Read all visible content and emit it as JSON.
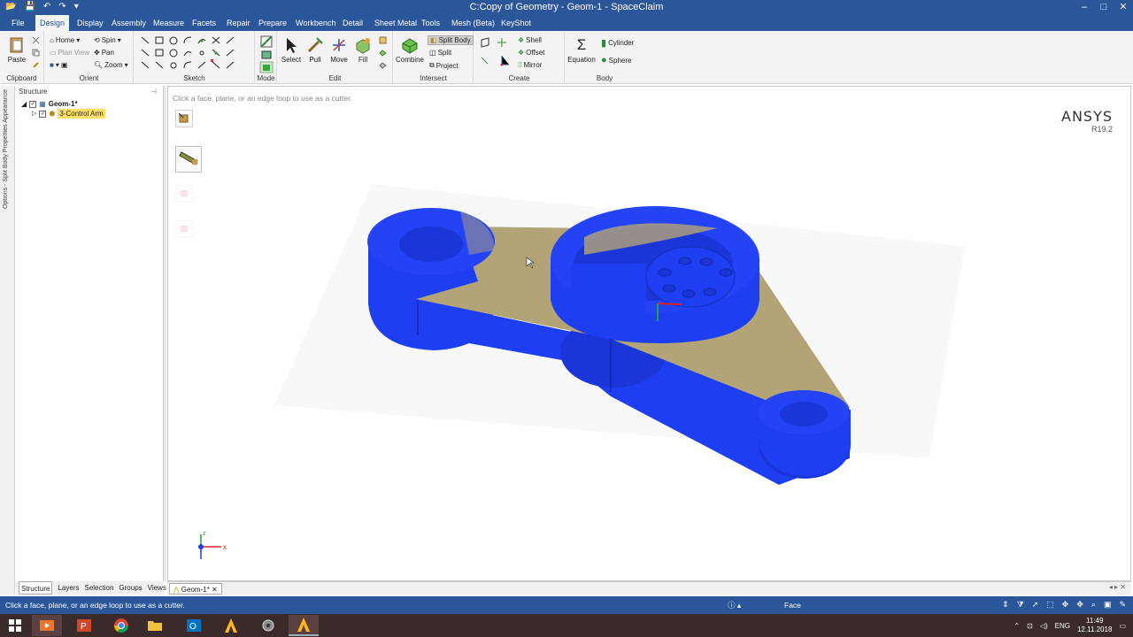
{
  "window": {
    "title": "C:Copy of Geometry - Geom-1 - SpaceClaim",
    "controls": [
      "–",
      "□",
      "✕"
    ]
  },
  "menu": {
    "tabs": [
      "File",
      "Design",
      "Display",
      "Assembly",
      "Measure",
      "Facets",
      "Repair",
      "Prepare",
      "Workbench",
      "Detail",
      "Sheet Metal",
      "Tools",
      "Mesh (Beta)",
      "KeyShot"
    ],
    "active": "Design"
  },
  "ribbon": {
    "clipboard": {
      "label": "Clipboard",
      "paste": "Paste"
    },
    "orient": {
      "label": "Orient",
      "home": "Home",
      "spin": "Spin",
      "plan_view": "Plan View",
      "pan": "Pan",
      "zoom": "Zoom"
    },
    "sketch": {
      "label": "Sketch"
    },
    "mode": {
      "label": "Mode"
    },
    "edit": {
      "label": "Edit",
      "select": "Select",
      "pull": "Pull",
      "move": "Move",
      "fill": "Fill"
    },
    "intersect": {
      "label": "Intersect",
      "combine": "Combine",
      "split_body": "Split Body",
      "split": "Split",
      "project": "Project"
    },
    "create": {
      "label": "Create",
      "shell": "Shell",
      "offset": "Offset",
      "mirror": "Mirror"
    },
    "body": {
      "label": "Body",
      "equation": "Equation",
      "cylinder": "Cylinder",
      "sphere": "Sphere"
    }
  },
  "side_strip": "Options - Split Body   Properties   Appearance",
  "structure": {
    "header": "Structure",
    "root": "Geom-1*",
    "child": "3-Control Arm",
    "bottom_tabs": [
      "Structure",
      "Layers",
      "Selection",
      "Groups",
      "Views"
    ]
  },
  "viewport": {
    "prompt": "Click a face, plane, or an edge loop to use as a cutter.",
    "brand": "ANSYS",
    "version": "R19.2",
    "axis_x": "x",
    "axis_z": "z"
  },
  "document_tab": "Geom-1*",
  "status": {
    "message": "Click a face, plane, or an edge loop to use as a cutter.",
    "selection_type": "Face"
  },
  "taskbar": {
    "lang": "ENG",
    "time": "11:49",
    "date": "12.11.2018"
  },
  "colors": {
    "accent": "#2b579a",
    "body_blue": "#1f3ff5",
    "split_plane": "#b3a477"
  }
}
